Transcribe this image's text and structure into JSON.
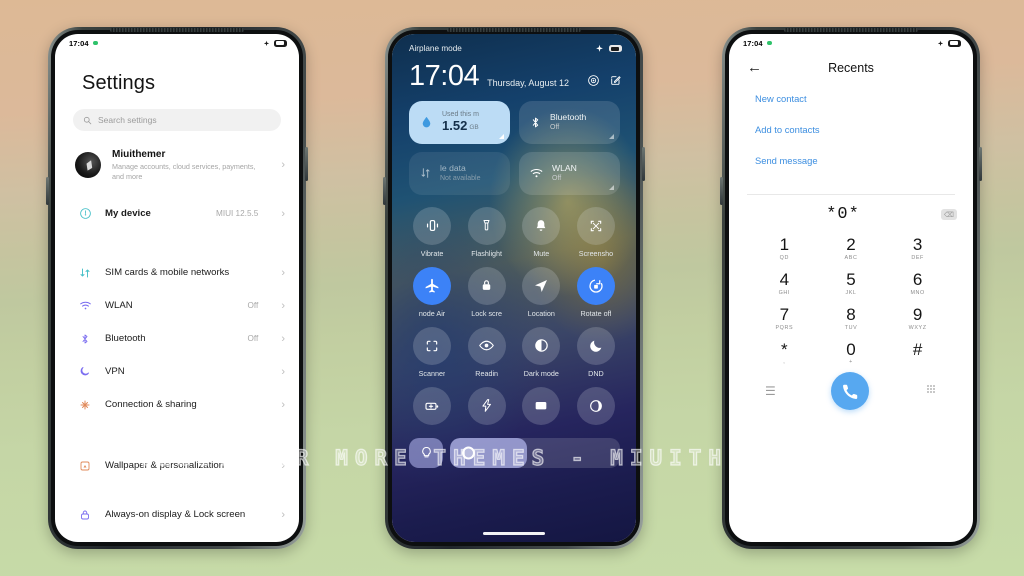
{
  "watermark": "VISIT FOR MORE THEMES - MIUITHEMER.COM",
  "background": {
    "top_color": "#ddb995",
    "bottom_color": "#c7dca8"
  },
  "phone_settings": {
    "status_bar": {
      "time": "17:04",
      "icons": [
        "green-dot",
        "airplane",
        "battery"
      ]
    },
    "title": "Settings",
    "search": {
      "placeholder": "Search settings"
    },
    "account": {
      "name": "Miuithemer",
      "subtitle": "Manage accounts, cloud services, payments, and more"
    },
    "items": [
      {
        "label": "My device",
        "value": "MIUI 12.5.5",
        "icon": "device-icon",
        "color": "#46c0c8"
      },
      {
        "label": "SIM cards & mobile networks",
        "value": "",
        "icon": "sim-icon",
        "color": "#46c0c8"
      },
      {
        "label": "WLAN",
        "value": "Off",
        "icon": "wifi-icon",
        "color": "#7a6cf0"
      },
      {
        "label": "Bluetooth",
        "value": "Off",
        "icon": "bluetooth-icon",
        "color": "#7a6cf0"
      },
      {
        "label": "VPN",
        "value": "",
        "icon": "vpn-icon",
        "color": "#7a6cf0"
      },
      {
        "label": "Connection & sharing",
        "value": "",
        "icon": "share-icon",
        "color": "#e08a5a"
      },
      {
        "label": "Wallpaper & personalization",
        "value": "",
        "icon": "wallpaper-icon",
        "color": "#e08a5a"
      },
      {
        "label": "Always-on display & Lock screen",
        "value": "",
        "icon": "lock-icon",
        "color": "#7a6cf0"
      }
    ]
  },
  "phone_control_center": {
    "status_label": "Airplane mode",
    "clock": "17:04",
    "date": "Thursday, August 12",
    "header_icons": [
      "settings-gear-icon",
      "edit-icon"
    ],
    "big_tiles": [
      {
        "type": "data",
        "caption": "Used this m",
        "value": "1.52",
        "unit": "GB",
        "icon": "water-drop-icon"
      },
      {
        "type": "normal",
        "label": "Bluetooth",
        "sub": "Off",
        "icon": "bluetooth-icon"
      },
      {
        "type": "normal",
        "label": "le data",
        "sub": "Not available",
        "icon": "mobile-data-icon"
      },
      {
        "type": "normal",
        "label": "WLAN",
        "sub": "Off",
        "icon": "wifi-icon"
      }
    ],
    "toggles": [
      {
        "label": "Vibrate",
        "icon": "vibrate-icon",
        "on": false
      },
      {
        "label": "Flashlight",
        "icon": "flashlight-icon",
        "on": false
      },
      {
        "label": "Mute",
        "icon": "bell-icon",
        "on": false
      },
      {
        "label": "Screensho",
        "icon": "screenshot-icon",
        "on": false
      },
      {
        "label": "node    Air",
        "icon": "airplane-icon",
        "on": true
      },
      {
        "label": "Lock scre",
        "icon": "lock-icon",
        "on": false
      },
      {
        "label": "Location",
        "icon": "location-icon",
        "on": false
      },
      {
        "label": "Rotate off",
        "icon": "rotate-icon",
        "on": true
      },
      {
        "label": "Scanner",
        "icon": "scanner-icon",
        "on": false
      },
      {
        "label": "Readin",
        "icon": "eye-icon",
        "on": false
      },
      {
        "label": "Dark mode",
        "icon": "contrast-icon",
        "on": false
      },
      {
        "label": "DND",
        "icon": "moon-icon",
        "on": false
      },
      {
        "label": "",
        "icon": "battery-saver-icon",
        "on": false
      },
      {
        "label": "",
        "icon": "flash-icon",
        "on": false
      },
      {
        "label": "",
        "icon": "cast-icon",
        "on": false
      },
      {
        "label": "",
        "icon": "theme-icon",
        "on": false
      }
    ],
    "sliders": [
      {
        "name": "brightness",
        "icon": "brightness-icon"
      },
      {
        "name": "volume",
        "icon": "volume-icon",
        "fill_percent": 45
      }
    ]
  },
  "phone_dialer": {
    "status_bar": {
      "time": "17:04"
    },
    "title": "Recents",
    "back_icon": "back-arrow-icon",
    "links": [
      "New contact",
      "Add to contacts",
      "Send message"
    ],
    "dialed_number": "*0*",
    "delete_icon": "backspace-icon",
    "keys": [
      {
        "digit": "1",
        "letters": "QD"
      },
      {
        "digit": "2",
        "letters": "ABC"
      },
      {
        "digit": "3",
        "letters": "DEF"
      },
      {
        "digit": "4",
        "letters": "GHI"
      },
      {
        "digit": "5",
        "letters": "JKL"
      },
      {
        "digit": "6",
        "letters": "MNO"
      },
      {
        "digit": "7",
        "letters": "PQRS"
      },
      {
        "digit": "8",
        "letters": "TUV"
      },
      {
        "digit": "9",
        "letters": "WXYZ"
      },
      {
        "digit": "*",
        "letters": ","
      },
      {
        "digit": "0",
        "letters": "+"
      },
      {
        "digit": "#",
        "letters": ""
      }
    ],
    "bottom_bar": {
      "menu_icon": "menu-icon",
      "call_icon": "phone-call-icon",
      "keypad_icon": "keypad-icon",
      "call_button_color": "#57a8f0"
    }
  }
}
